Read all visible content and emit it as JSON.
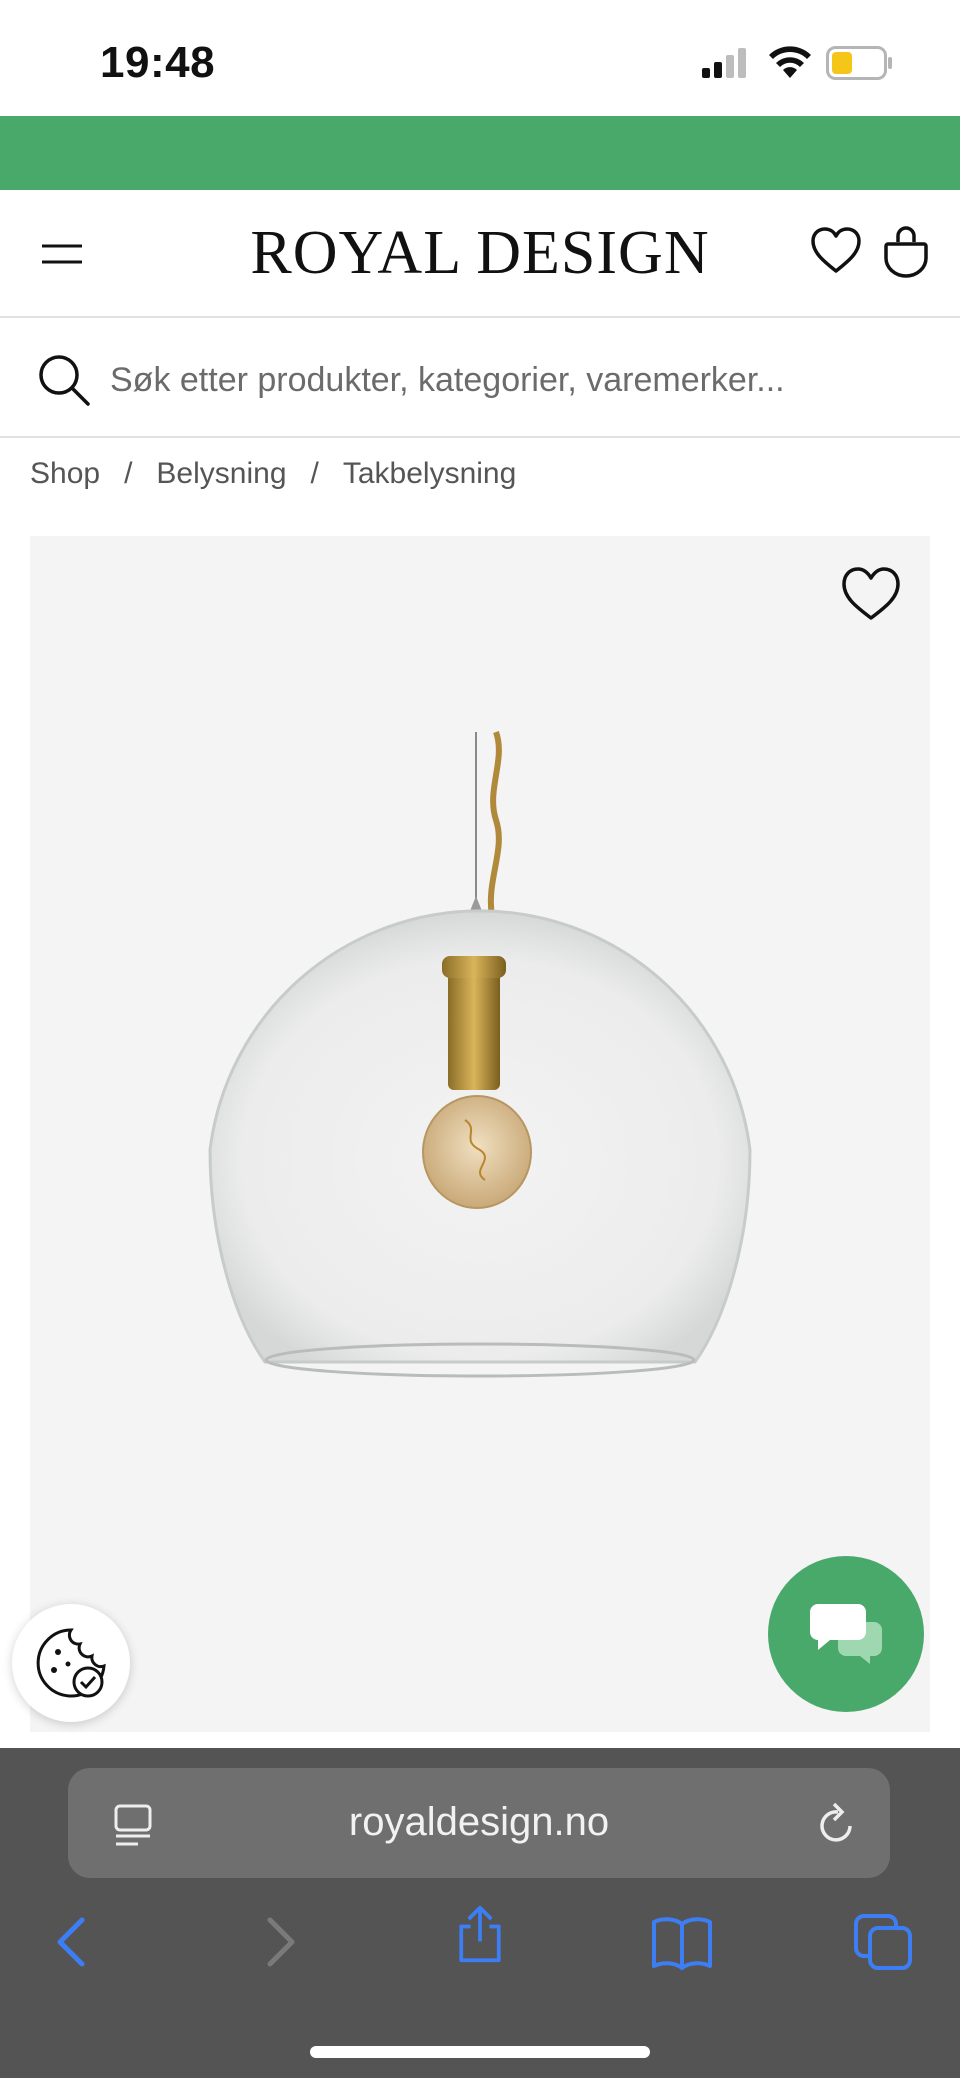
{
  "status_bar": {
    "time": "19:48"
  },
  "header": {
    "logo": "ROYAL DESIGN",
    "icons": {
      "menu": "hamburger-menu-icon",
      "wishlist": "heart-icon",
      "cart": "shopping-bag-icon"
    }
  },
  "search": {
    "placeholder": "Søk etter produkter, kategorier, varemerker..."
  },
  "breadcrumb": {
    "items": [
      "Shop",
      "Belysning",
      "Takbelysning"
    ],
    "separator": "/"
  },
  "product": {
    "image": "glass-globe-pendant-lamp",
    "favorite_icon": "heart-icon"
  },
  "floating": {
    "cookie_icon": "cookie-check-icon",
    "chat_icon": "chat-bubbles-icon"
  },
  "browser": {
    "url": "royaldesign.no"
  },
  "colors": {
    "brand_green": "#49a96b",
    "browser_accent": "#3d7ef5",
    "browser_bg": "#545454"
  }
}
